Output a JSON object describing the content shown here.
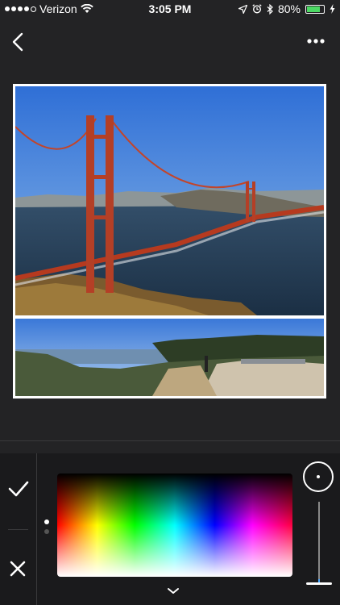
{
  "status_bar": {
    "carrier": "Verizon",
    "time": "3:05 PM",
    "battery_percent": "80%",
    "battery_level": 0.8,
    "signal_bars_filled": 4,
    "signal_bars_total": 5
  },
  "nav": {
    "back_icon": "chevron-left-icon",
    "more_icon": "ellipsis-icon"
  },
  "collage": {
    "photos": [
      {
        "subject": "golden-gate-bridge-photo"
      },
      {
        "subject": "coastal-panorama-photo"
      }
    ]
  },
  "color_panel": {
    "confirm_icon": "checkmark-icon",
    "cancel_icon": "close-icon",
    "page_count": 2,
    "active_page": 1,
    "slider_value": 0.04,
    "collapse_icon": "chevron-down-icon"
  }
}
